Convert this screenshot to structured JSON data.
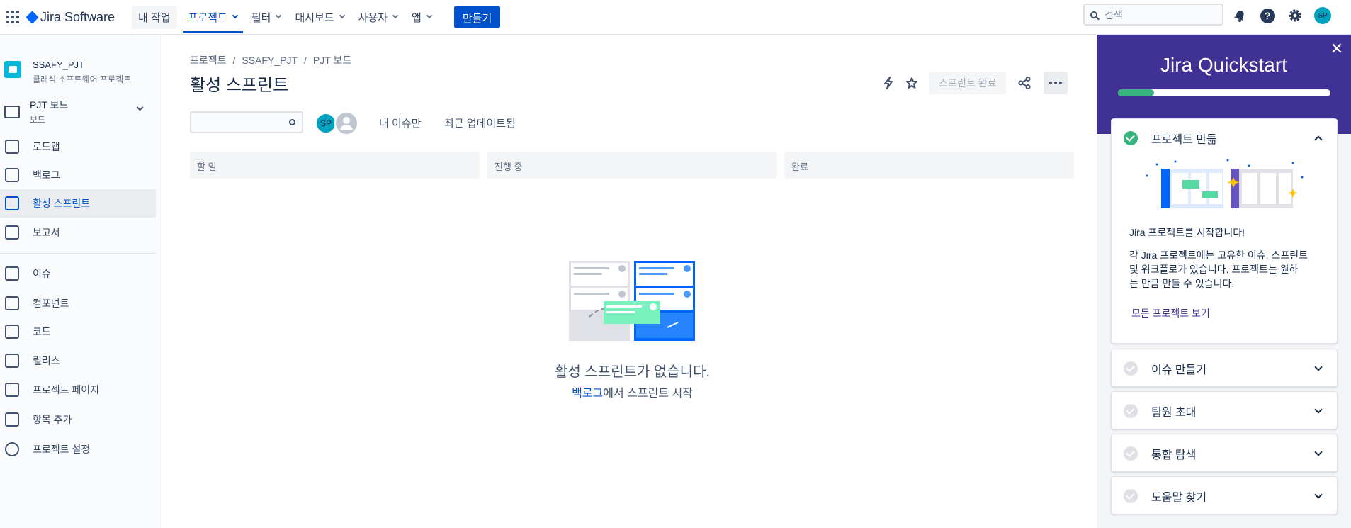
{
  "app": {
    "logo_text": "Jira Software"
  },
  "nav": {
    "my_work": "내 작업",
    "items": [
      {
        "label": "프로젝트"
      },
      {
        "label": "필터"
      },
      {
        "label": "대시보드"
      },
      {
        "label": "사용자"
      },
      {
        "label": "앱"
      }
    ],
    "create": "만들기",
    "search_placeholder": "검색",
    "avatar": "SP"
  },
  "sidebar": {
    "project_name": "SSAFY_PJT",
    "project_type": "클래식 소프트웨어 프로젝트",
    "board_name": "PJT 보드",
    "board_type": "보드",
    "items": [
      {
        "label": "로드맵"
      },
      {
        "label": "백로그"
      },
      {
        "label": "활성 스프린트"
      },
      {
        "label": "보고서"
      },
      {
        "label": "이슈"
      },
      {
        "label": "컴포넌트"
      },
      {
        "label": "코드"
      },
      {
        "label": "릴리스"
      },
      {
        "label": "프로젝트 페이지"
      },
      {
        "label": "항목 추가"
      },
      {
        "label": "프로젝트 설정"
      }
    ]
  },
  "breadcrumb": [
    "프로젝트",
    "SSAFY_PJT",
    "PJT 보드"
  ],
  "page_title": "활성 스프린트",
  "toolbar": {
    "complete_sprint": "스프린트 완료"
  },
  "filters": {
    "avatar": "SP",
    "my_issues": "내 이슈만",
    "recent": "최근 업데이트됨"
  },
  "columns": [
    "할 일",
    "진행 중",
    "완료"
  ],
  "empty": {
    "title": "활성 스프린트가 없습니다.",
    "link": "백로그",
    "suffix": "에서 스프린트 시작"
  },
  "quickstart": {
    "title": "Jira Quickstart",
    "progress": 0.17,
    "sections": [
      {
        "label": "프로젝트 만듦",
        "done": true,
        "heading": "Jira 프로젝트를 시작합니다!",
        "body_lines": [
          "각 Jira 프로젝트에는 고유한 이슈, 스프린트",
          "및 워크플로가 있습니다. 프로젝트는 원하",
          "는 만큼 만들 수 있습니다."
        ],
        "link": "모든 프로젝트 보기"
      },
      {
        "label": "이슈 만들기",
        "done": false
      },
      {
        "label": "팀원 초대",
        "done": false
      },
      {
        "label": "통합 탐색",
        "done": false
      },
      {
        "label": "도움말 찾기",
        "done": false
      }
    ]
  },
  "colors": {
    "brand": "#0052cc",
    "quickstart": "#403294",
    "success": "#36b37e"
  }
}
